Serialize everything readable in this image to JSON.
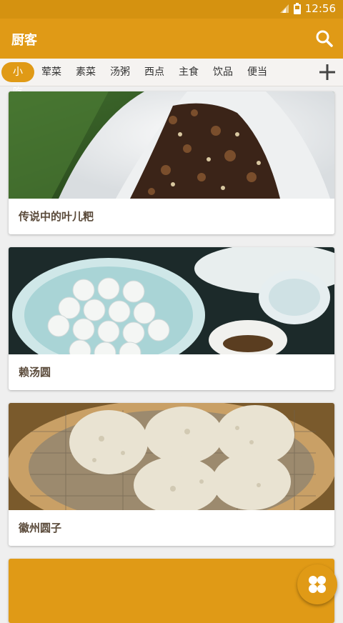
{
  "status_bar": {
    "time": "12:56"
  },
  "app_bar": {
    "title": "厨客"
  },
  "tabs": [
    {
      "label": "小吃",
      "active": true
    },
    {
      "label": "荤菜"
    },
    {
      "label": "素菜"
    },
    {
      "label": "汤粥"
    },
    {
      "label": "西点"
    },
    {
      "label": "主食"
    },
    {
      "label": "饮品"
    },
    {
      "label": "便当"
    }
  ],
  "cards": [
    {
      "title": "传说中的叶儿粑"
    },
    {
      "title": "赖汤圆"
    },
    {
      "title": "徽州圆子"
    },
    {
      "title": ""
    }
  ],
  "colors": {
    "primary": "#e09a16",
    "status_bar": "#d59210",
    "text_title": "#5a4a3a"
  },
  "icons": [
    "signal-icon",
    "battery-icon",
    "search-icon",
    "add-icon",
    "grid-icon"
  ]
}
